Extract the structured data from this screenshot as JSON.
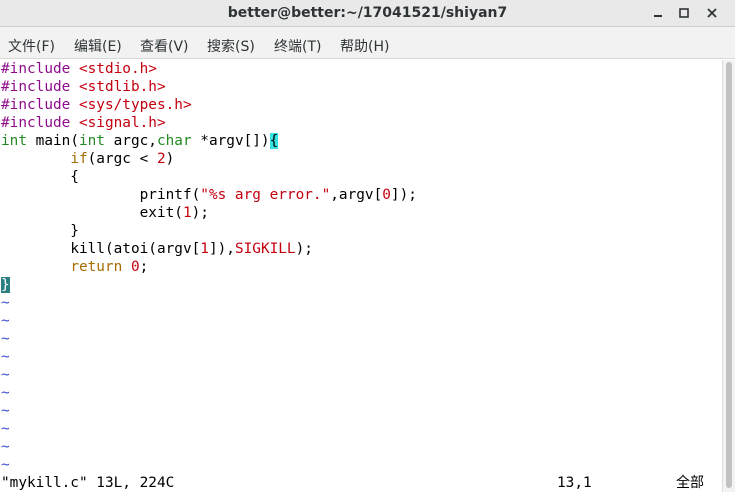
{
  "window": {
    "title": "better@better:~/17041521/shiyan7"
  },
  "menu": {
    "file": "文件(F)",
    "edit": "编辑(E)",
    "view": "查看(V)",
    "search": "搜索(S)",
    "terminal": "终端(T)",
    "help": "帮助(H)"
  },
  "code": {
    "l1": {
      "a": "#include ",
      "b": "<stdio.h>"
    },
    "l2": {
      "a": "#include ",
      "b": "<stdlib.h>"
    },
    "l3": {
      "a": "#include ",
      "b": "<sys/types.h>"
    },
    "l4": {
      "a": "#include ",
      "b": "<signal.h>"
    },
    "l5": {
      "t1": "int",
      "a": " main(",
      "t2": "int",
      "b": " argc,",
      "t3": "char",
      "c": " *argv[])",
      "brace": "{"
    },
    "l6": {
      "ind": "        ",
      "kw": "if",
      "a": "(argc < ",
      "num": "2",
      "b": ")"
    },
    "l7": {
      "text": "        {"
    },
    "l8": {
      "ind": "                ",
      "a": "printf(",
      "str": "\"%s arg error.\"",
      "b": ",argv[",
      "num": "0",
      "c": "]);"
    },
    "l9": {
      "ind": "                ",
      "a": "exit(",
      "num": "1",
      "b": ");"
    },
    "l10": {
      "text": "        }"
    },
    "l11": {
      "ind": "        ",
      "a": "kill(atoi(argv[",
      "num": "1",
      "b": "]),",
      "sig": "SIGKILL",
      "c": ");"
    },
    "l12": {
      "ind": "        ",
      "kw": "return",
      "a": " ",
      "num": "0",
      "b": ";"
    },
    "l13": {
      "cursor": "}"
    },
    "tilde": "~"
  },
  "status": {
    "file": "\"mykill.c\" 13L, 224C",
    "position": "13,1",
    "scroll": "全部"
  },
  "colors": {
    "preprocessor": "#8e0c8c",
    "string": "#c4000f",
    "type": "#248a24",
    "keyword": "#a66d00",
    "tilde": "#3f4fd8",
    "cursor": "#2a7f83",
    "match": "#34e0e0"
  }
}
